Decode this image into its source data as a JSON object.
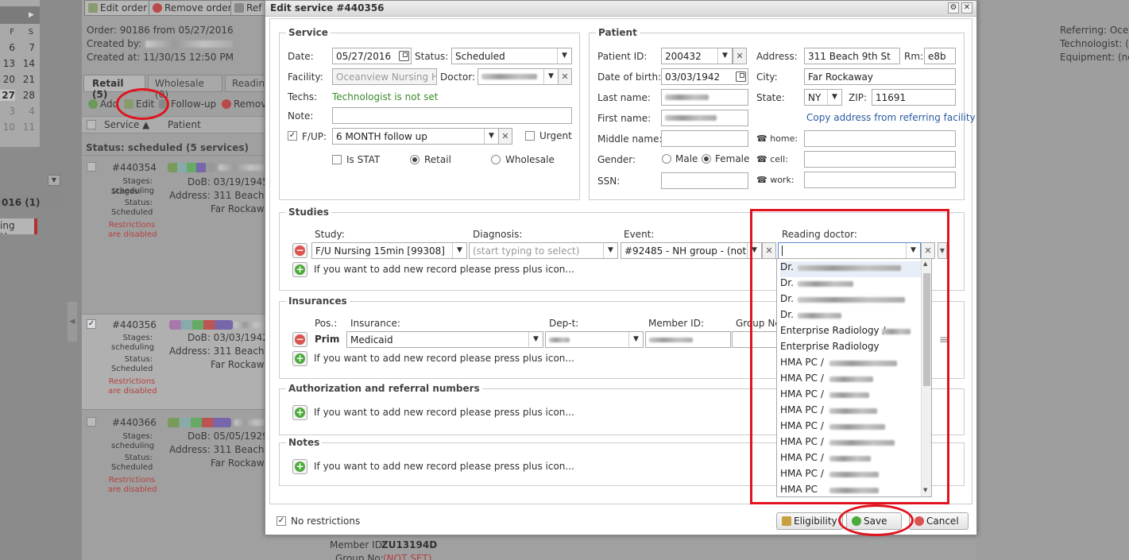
{
  "background": {
    "calendar": {
      "weekdays": [
        "F",
        "S"
      ],
      "rows": [
        [
          "6",
          "7"
        ],
        [
          "13",
          "14"
        ],
        [
          "20",
          "21"
        ],
        [
          "27",
          "28"
        ],
        [
          "3",
          "4"
        ],
        [
          "10",
          "11"
        ]
      ]
    },
    "left_group": "016 (1)",
    "left_chip": "ing Ho..",
    "toolbar": {
      "edit_order": "Edit order",
      "remove_order": "Remove order",
      "ref": "Ref"
    },
    "order_info": {
      "line1": "Order: 90186 from 05/27/2016",
      "line2": "Created by:",
      "line3": "Created at: 11/30/15 12:50 PM"
    },
    "tabs": [
      "Retail (5)",
      "Wholesale (0)",
      "Reading"
    ],
    "actions": {
      "add": "Add",
      "edit": "Edit",
      "follow_up": "Follow-up",
      "remove": "Remov"
    },
    "columns": {
      "service": "Service ▲",
      "patient": "Patient"
    },
    "status_group": "Status: scheduled (5 services)",
    "rows": [
      {
        "id": "#440354",
        "stages_label": "Stages:",
        "stages": "scheduling",
        "status_label": "Status:",
        "status": "Scheduled",
        "restrict1": "Restrictions",
        "restrict2": "are disabled",
        "dob": "DoB: 03/19/1945",
        "address": "Address: 311 Beach 9",
        "city": "Far Rockawa"
      },
      {
        "id": "#440356",
        "stages_label": "Stages:",
        "stages": "scheduling",
        "status_label": "Status:",
        "status": "Scheduled",
        "restrict1": "Restrictions",
        "restrict2": "are disabled",
        "dob": "DoB: 03/03/1942",
        "address": "Address: 311 Beach 9",
        "city": "Far Rockawa"
      },
      {
        "id": "#440366",
        "stages_label": "Stages:",
        "stages": "scheduling",
        "status_label": "Status:",
        "status": "Scheduled",
        "restrict1": "Restrictions",
        "restrict2": "are disabled",
        "dob": "DoB: 05/05/1929",
        "address": "Address: 311 Beach 9",
        "city": "Far Rockawa"
      }
    ],
    "right_info": {
      "referring": "Referring: Ocear",
      "technologist": "Technologist: (no",
      "equipment": "Equipment: (no"
    },
    "bottom": {
      "member_id_label": "Member ID:",
      "member_id": "ZU13194D",
      "group_no_label": "Group No:",
      "group_no": "(NOT SET)"
    }
  },
  "dialog": {
    "title": "Edit service #440356",
    "service": {
      "legend": "Service",
      "date_label": "Date:",
      "date": "05/27/2016",
      "status_label": "Status:",
      "status": "Scheduled",
      "facility_label": "Facility:",
      "facility": "Oceanview Nursing Hor",
      "doctor_label": "Doctor:",
      "techs_label": "Techs:",
      "techs": "Technologist is not set",
      "note_label": "Note:",
      "fup_label": "F/UP:",
      "fup": "6 MONTH follow up",
      "urgent_label": "Urgent",
      "stat_label": "Is STAT",
      "retail_label": "Retail",
      "wholesale_label": "Wholesale"
    },
    "patient": {
      "legend": "Patient",
      "id_label": "Patient ID:",
      "id": "200432",
      "dob_label": "Date of birth:",
      "dob": "03/03/1942",
      "last_name_label": "Last name:",
      "first_name_label": "First name:",
      "middle_name_label": "Middle name:",
      "gender_label": "Gender:",
      "male": "Male",
      "female": "Female",
      "ssn_label": "SSN:",
      "address_label": "Address:",
      "address": "311 Beach 9th St",
      "rm_label": "Rm:",
      "rm": "e8b",
      "city_label": "City:",
      "city": "Far Rockaway",
      "state_label": "State:",
      "state": "NY",
      "zip_label": "ZIP:",
      "zip": "11691",
      "copy_link": "Copy address from referring facility",
      "home_label": "home:",
      "cell_label": "cell:",
      "work_label": "work:"
    },
    "studies": {
      "legend": "Studies",
      "study_header": "Study:",
      "diagnosis_header": "Diagnosis:",
      "event_header": "Event:",
      "reading_header": "Reading doctor:",
      "study": "F/U Nursing 15min [99308]",
      "diagnosis_placeholder": "(start typing to select)",
      "event": "#92485 - NH group - (not se",
      "add_hint": "If you want to add new record please press plus icon..."
    },
    "reading_dropdown": {
      "items": [
        "Dr.",
        "Dr.",
        "Dr.",
        "Dr.",
        "Enterprise Radiology /",
        "Enterprise Radiology",
        "HMA PC /",
        "HMA PC /",
        "HMA PC /",
        "HMA PC /",
        "HMA PC /",
        "HMA PC /",
        "HMA PC /",
        "HMA PC /",
        "HMA PC"
      ]
    },
    "insurances": {
      "legend": "Insurances",
      "pos_header": "Pos.:",
      "insurance_header": "Insurance:",
      "dept_header": "Dep-t:",
      "member_header": "Member ID:",
      "group_header": "Group No",
      "pos": "Prim",
      "insurance": "Medicaid",
      "add_hint": "If you want to add new record please press plus icon..."
    },
    "authorization": {
      "legend": "Authorization and referral numbers",
      "add_hint": "If you want to add new record please press plus icon..."
    },
    "notes": {
      "legend": "Notes",
      "add_hint": "If you want to add new record please press plus icon..."
    },
    "footer": {
      "no_restrictions": "No restrictions",
      "eligibility": "Eligibility",
      "save": "Save",
      "cancel": "Cancel"
    }
  },
  "colors": {
    "annotation_red": "#e0141e",
    "link_blue": "#2a5aa0",
    "success_green": "#3a8a2a"
  }
}
